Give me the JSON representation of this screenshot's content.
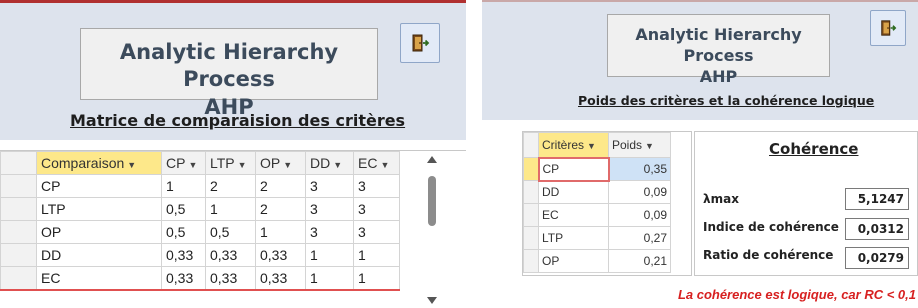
{
  "left": {
    "title_line1": "Analytic Hierarchy Process",
    "title_line2": "AHP",
    "subtitle": "Matrice de comparaision des critères",
    "exit_icon": "exit-door-icon",
    "table": {
      "headers": [
        "Comparaison",
        "CP",
        "LTP",
        "OP",
        "DD",
        "EC"
      ],
      "rows": [
        [
          "CP",
          "1",
          "2",
          "2",
          "3",
          "3"
        ],
        [
          "LTP",
          "0,5",
          "1",
          "2",
          "3",
          "3"
        ],
        [
          "OP",
          "0,5",
          "0,5",
          "1",
          "3",
          "3"
        ],
        [
          "DD",
          "0,33",
          "0,33",
          "0,33",
          "1",
          "1"
        ],
        [
          "EC",
          "0,33",
          "0,33",
          "0,33",
          "1",
          "1"
        ]
      ]
    }
  },
  "right": {
    "title_line1": "Analytic Hierarchy Process",
    "title_line2": "AHP",
    "subtitle": "Poids des critères et la cohérence logique",
    "exit_icon": "exit-door-icon",
    "table": {
      "headers": [
        "Critères",
        "Poids"
      ],
      "rows": [
        [
          "CP",
          "0,35"
        ],
        [
          "DD",
          "0,09"
        ],
        [
          "EC",
          "0,09"
        ],
        [
          "LTP",
          "0,27"
        ],
        [
          "OP",
          "0,21"
        ]
      ]
    },
    "coherence": {
      "title": "Cohérence",
      "lambda_label": "λmax",
      "lambda_value": "5,1247",
      "ci_label": "Indice de cohérence",
      "ci_value": "0,0312",
      "cr_label": "Ratio de cohérence",
      "cr_value": "0,0279"
    },
    "conclusion": "La cohérence est logique, car RC < 0,1"
  },
  "colors": {
    "header_band": "#dde3ed",
    "selected_header": "#fde88a",
    "conclusion_red": "#d72020",
    "accent_red": "#b03030"
  }
}
